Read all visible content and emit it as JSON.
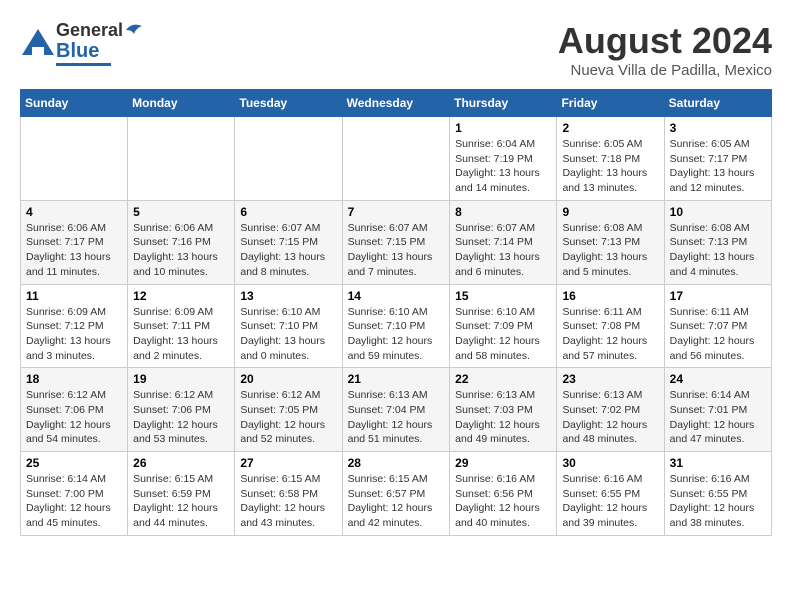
{
  "header": {
    "logo_general": "General",
    "logo_blue": "Blue",
    "month_year": "August 2024",
    "location": "Nueva Villa de Padilla, Mexico"
  },
  "weekdays": [
    "Sunday",
    "Monday",
    "Tuesday",
    "Wednesday",
    "Thursday",
    "Friday",
    "Saturday"
  ],
  "weeks": [
    [
      {
        "day": "",
        "info": ""
      },
      {
        "day": "",
        "info": ""
      },
      {
        "day": "",
        "info": ""
      },
      {
        "day": "",
        "info": ""
      },
      {
        "day": "1",
        "info": "Sunrise: 6:04 AM\nSunset: 7:19 PM\nDaylight: 13 hours\nand 14 minutes."
      },
      {
        "day": "2",
        "info": "Sunrise: 6:05 AM\nSunset: 7:18 PM\nDaylight: 13 hours\nand 13 minutes."
      },
      {
        "day": "3",
        "info": "Sunrise: 6:05 AM\nSunset: 7:17 PM\nDaylight: 13 hours\nand 12 minutes."
      }
    ],
    [
      {
        "day": "4",
        "info": "Sunrise: 6:06 AM\nSunset: 7:17 PM\nDaylight: 13 hours\nand 11 minutes."
      },
      {
        "day": "5",
        "info": "Sunrise: 6:06 AM\nSunset: 7:16 PM\nDaylight: 13 hours\nand 10 minutes."
      },
      {
        "day": "6",
        "info": "Sunrise: 6:07 AM\nSunset: 7:15 PM\nDaylight: 13 hours\nand 8 minutes."
      },
      {
        "day": "7",
        "info": "Sunrise: 6:07 AM\nSunset: 7:15 PM\nDaylight: 13 hours\nand 7 minutes."
      },
      {
        "day": "8",
        "info": "Sunrise: 6:07 AM\nSunset: 7:14 PM\nDaylight: 13 hours\nand 6 minutes."
      },
      {
        "day": "9",
        "info": "Sunrise: 6:08 AM\nSunset: 7:13 PM\nDaylight: 13 hours\nand 5 minutes."
      },
      {
        "day": "10",
        "info": "Sunrise: 6:08 AM\nSunset: 7:13 PM\nDaylight: 13 hours\nand 4 minutes."
      }
    ],
    [
      {
        "day": "11",
        "info": "Sunrise: 6:09 AM\nSunset: 7:12 PM\nDaylight: 13 hours\nand 3 minutes."
      },
      {
        "day": "12",
        "info": "Sunrise: 6:09 AM\nSunset: 7:11 PM\nDaylight: 13 hours\nand 2 minutes."
      },
      {
        "day": "13",
        "info": "Sunrise: 6:10 AM\nSunset: 7:10 PM\nDaylight: 13 hours\nand 0 minutes."
      },
      {
        "day": "14",
        "info": "Sunrise: 6:10 AM\nSunset: 7:10 PM\nDaylight: 12 hours\nand 59 minutes."
      },
      {
        "day": "15",
        "info": "Sunrise: 6:10 AM\nSunset: 7:09 PM\nDaylight: 12 hours\nand 58 minutes."
      },
      {
        "day": "16",
        "info": "Sunrise: 6:11 AM\nSunset: 7:08 PM\nDaylight: 12 hours\nand 57 minutes."
      },
      {
        "day": "17",
        "info": "Sunrise: 6:11 AM\nSunset: 7:07 PM\nDaylight: 12 hours\nand 56 minutes."
      }
    ],
    [
      {
        "day": "18",
        "info": "Sunrise: 6:12 AM\nSunset: 7:06 PM\nDaylight: 12 hours\nand 54 minutes."
      },
      {
        "day": "19",
        "info": "Sunrise: 6:12 AM\nSunset: 7:06 PM\nDaylight: 12 hours\nand 53 minutes."
      },
      {
        "day": "20",
        "info": "Sunrise: 6:12 AM\nSunset: 7:05 PM\nDaylight: 12 hours\nand 52 minutes."
      },
      {
        "day": "21",
        "info": "Sunrise: 6:13 AM\nSunset: 7:04 PM\nDaylight: 12 hours\nand 51 minutes."
      },
      {
        "day": "22",
        "info": "Sunrise: 6:13 AM\nSunset: 7:03 PM\nDaylight: 12 hours\nand 49 minutes."
      },
      {
        "day": "23",
        "info": "Sunrise: 6:13 AM\nSunset: 7:02 PM\nDaylight: 12 hours\nand 48 minutes."
      },
      {
        "day": "24",
        "info": "Sunrise: 6:14 AM\nSunset: 7:01 PM\nDaylight: 12 hours\nand 47 minutes."
      }
    ],
    [
      {
        "day": "25",
        "info": "Sunrise: 6:14 AM\nSunset: 7:00 PM\nDaylight: 12 hours\nand 45 minutes."
      },
      {
        "day": "26",
        "info": "Sunrise: 6:15 AM\nSunset: 6:59 PM\nDaylight: 12 hours\nand 44 minutes."
      },
      {
        "day": "27",
        "info": "Sunrise: 6:15 AM\nSunset: 6:58 PM\nDaylight: 12 hours\nand 43 minutes."
      },
      {
        "day": "28",
        "info": "Sunrise: 6:15 AM\nSunset: 6:57 PM\nDaylight: 12 hours\nand 42 minutes."
      },
      {
        "day": "29",
        "info": "Sunrise: 6:16 AM\nSunset: 6:56 PM\nDaylight: 12 hours\nand 40 minutes."
      },
      {
        "day": "30",
        "info": "Sunrise: 6:16 AM\nSunset: 6:55 PM\nDaylight: 12 hours\nand 39 minutes."
      },
      {
        "day": "31",
        "info": "Sunrise: 6:16 AM\nSunset: 6:55 PM\nDaylight: 12 hours\nand 38 minutes."
      }
    ]
  ]
}
